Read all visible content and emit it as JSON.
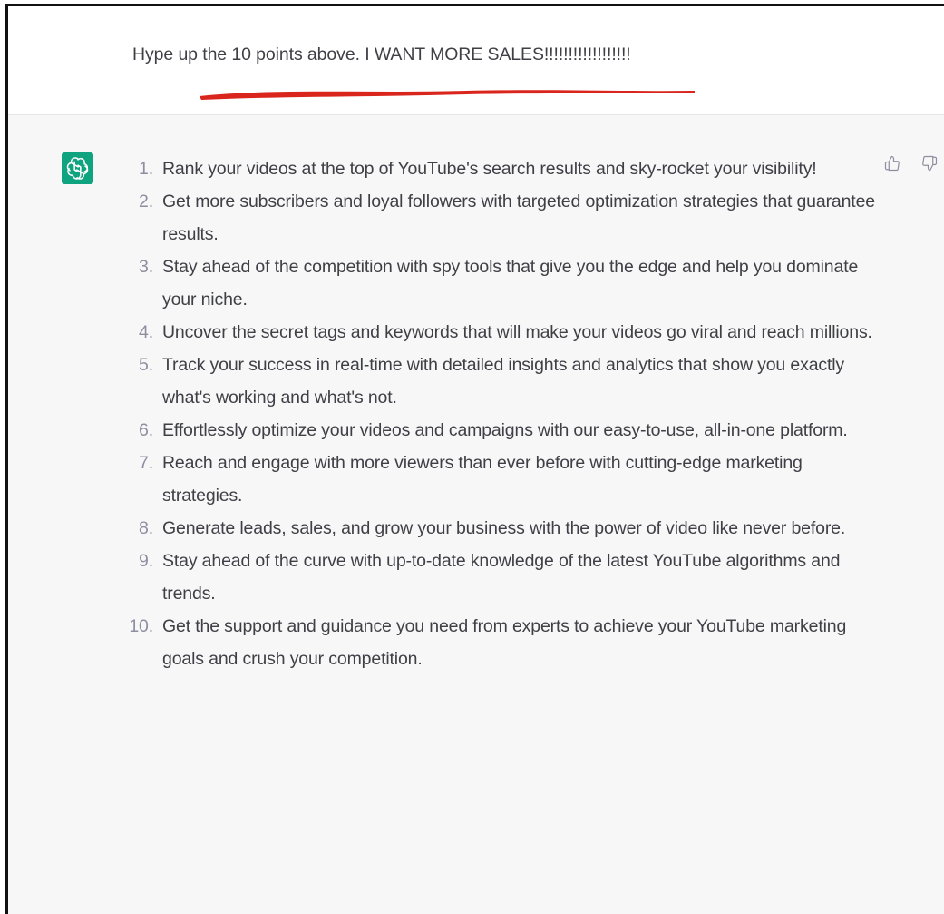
{
  "user_message": {
    "text": "Hype up the 10 points above. I WANT MORE SALES!!!!!!!!!!!!!!!!!!"
  },
  "annotation": {
    "underline_color": "#d9251c"
  },
  "assistant_message": {
    "avatar_icon": "chatgpt-logo-icon",
    "avatar_color": "#10a37f",
    "feedback_icons": [
      "thumbs-up-icon",
      "thumbs-down-icon"
    ],
    "points": [
      {
        "num": "1.",
        "text": "Rank your videos at the top of YouTube's search results and sky-rocket your visibility!"
      },
      {
        "num": "2.",
        "text": "Get more subscribers and loyal followers with targeted optimization strategies that guarantee results."
      },
      {
        "num": "3.",
        "text": "Stay ahead of the competition with spy tools that give you the edge and help you dominate your niche."
      },
      {
        "num": "4.",
        "text": "Uncover the secret tags and keywords that will make your videos go viral and reach millions."
      },
      {
        "num": "5.",
        "text": "Track your success in real-time with detailed insights and analytics that show you exactly what's working and what's not."
      },
      {
        "num": "6.",
        "text": "Effortlessly optimize your videos and campaigns with our easy-to-use, all-in-one platform."
      },
      {
        "num": "7.",
        "text": "Reach and engage with more viewers than ever before with cutting-edge marketing strategies."
      },
      {
        "num": "8.",
        "text": "Generate leads, sales, and grow your business with the power of video like never before."
      },
      {
        "num": "9.",
        "text": "Stay ahead of the curve with up-to-date knowledge of the latest YouTube algorithms and trends."
      },
      {
        "num": "10.",
        "text": "Get the support and guidance you need from experts to achieve your YouTube marketing goals and crush your competition."
      }
    ]
  }
}
